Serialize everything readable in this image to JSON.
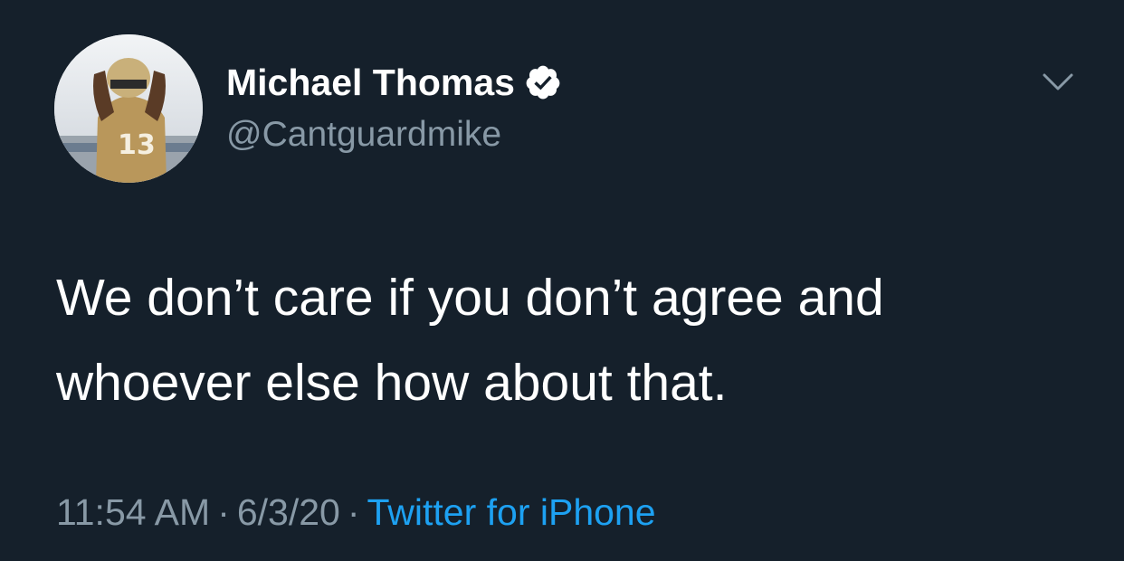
{
  "tweet": {
    "display_name": "Michael Thomas",
    "handle": "@Cantguardmike",
    "verified": true,
    "avatar_icon": "profile-photo",
    "text": "We don’t care if you don’t agree and\nwhoever else how about that.",
    "time": "11:54 AM",
    "date": "6/3/20",
    "separator": "·",
    "source": "Twitter for iPhone",
    "menu_icon": "chevron-down-icon"
  },
  "colors": {
    "background": "#15202b",
    "text_primary": "#ffffff",
    "text_secondary": "#8899a6",
    "link": "#1da1f2",
    "verified_badge": "#ffffff"
  }
}
